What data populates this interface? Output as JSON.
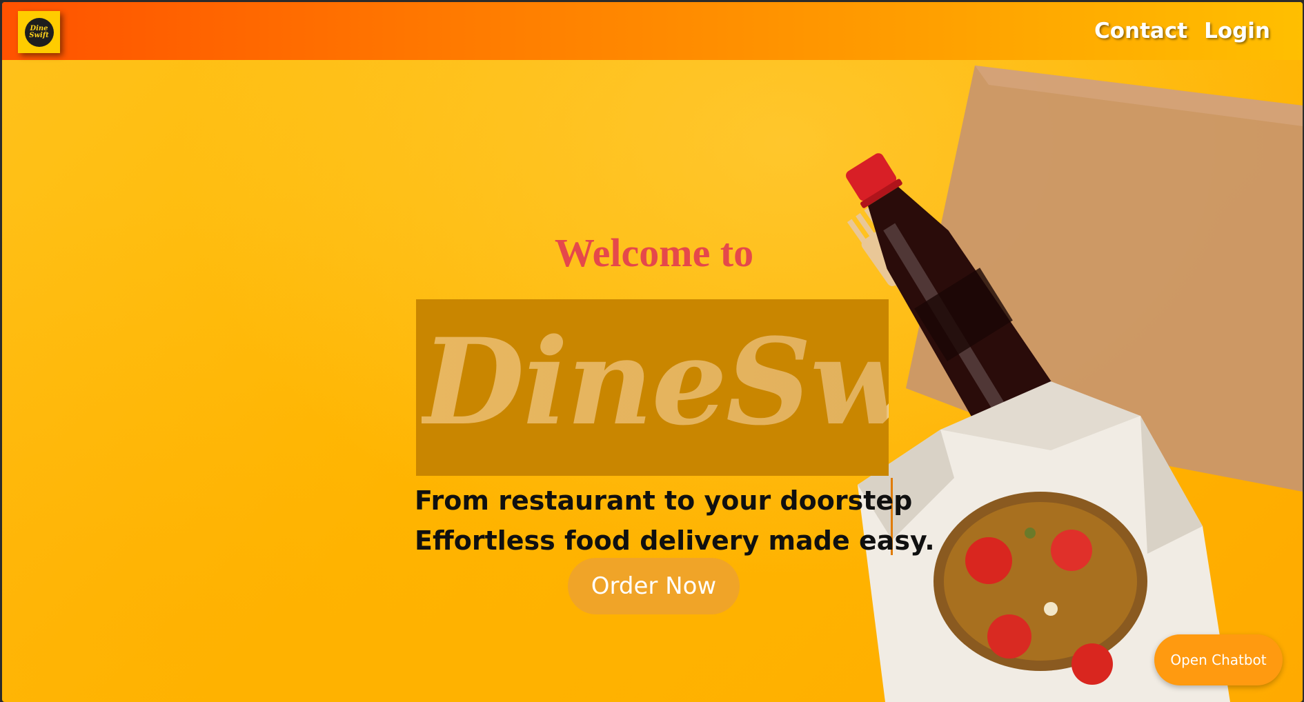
{
  "navbar": {
    "logo_line1": "Dine",
    "logo_line2": "Swift",
    "links": [
      {
        "label": "Contact"
      },
      {
        "label": "Login"
      }
    ]
  },
  "hero": {
    "welcome": "Welcome to",
    "brand": "DineSwift",
    "tagline_line1": "From restaurant to your doorstep",
    "tagline_line2": "Effortless food delivery made easy.",
    "order_button": "Order Now"
  },
  "chatbot_button": "Open Chatbot",
  "decor": {
    "illustration": [
      "cola-bottle",
      "wooden-fork",
      "kraft-paper",
      "noodle-takeout-box"
    ]
  },
  "colors": {
    "nav_gradient_start": "#ff5200",
    "nav_gradient_end": "#ffbf00",
    "background": "#ffb800",
    "welcome_text": "#e5484b",
    "brand_box": "#c98600",
    "order_button": "#f0a428",
    "chatbot_button": "#ff9a10"
  }
}
